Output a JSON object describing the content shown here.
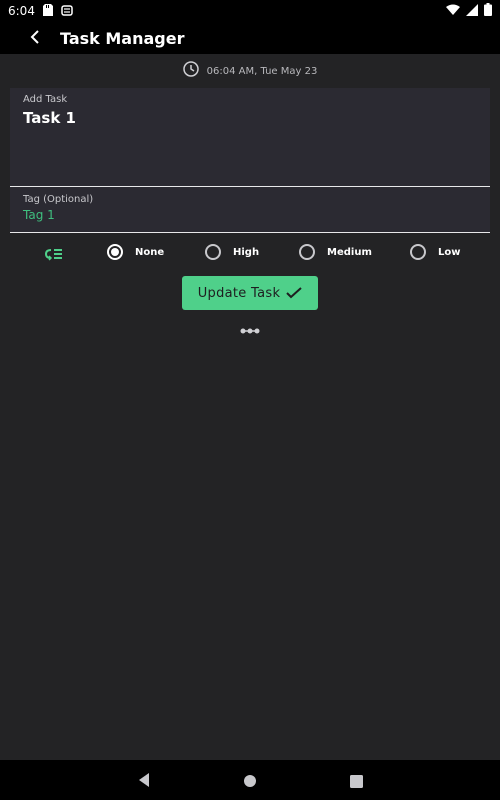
{
  "status_bar": {
    "time": "6:04",
    "icons": [
      "sd-card-icon",
      "cat-icon",
      "wifi-icon",
      "signal-icon",
      "battery-icon"
    ]
  },
  "app_bar": {
    "title": "Task Manager",
    "back_icon": "chevron-left-icon"
  },
  "datetime": {
    "icon": "clock-icon",
    "text": "06:04 AM, Tue May 23"
  },
  "task": {
    "label": "Add Task",
    "value": "Task 1"
  },
  "tag": {
    "label": "Tag (Optional)",
    "value": "Tag 1"
  },
  "priority": {
    "icon": "priority-list-icon",
    "options": [
      {
        "label": "None",
        "selected": true
      },
      {
        "label": "High",
        "selected": false
      },
      {
        "label": "Medium",
        "selected": false
      },
      {
        "label": "Low",
        "selected": false
      }
    ]
  },
  "actions": {
    "update_label": "Update Task",
    "update_icon": "check-icon",
    "more_icon": "more-horizontal-icon"
  },
  "colors": {
    "accent": "#4fd08a",
    "tag_text": "#3fbf7f",
    "background": "#232325",
    "panel": "#2b2a32",
    "bar": "#000000"
  }
}
